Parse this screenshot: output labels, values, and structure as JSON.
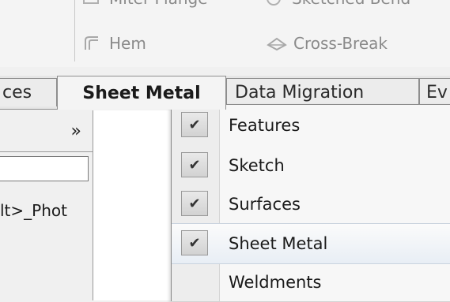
{
  "ribbon": {
    "top_items": [
      {
        "label": "Miter Flange",
        "icon": "miter-flange-icon"
      },
      {
        "label": "Sketched Bend",
        "icon": "sketched-bend-icon"
      }
    ],
    "hem_label": "Hem",
    "hem_icon": "hem-icon",
    "crossbreak_label": "Cross-Break",
    "crossbreak_icon": "cross-break-icon"
  },
  "tabs": {
    "prev_label": "ces",
    "active_label": "Sheet Metal",
    "next1_label": "Data Migration",
    "next2_label": "Ev"
  },
  "left_panel": {
    "expand_glyph": "»",
    "tree_text": "lt>_Phot"
  },
  "menu": {
    "items": [
      {
        "label": "Features",
        "checked": true
      },
      {
        "label": "Sketch",
        "checked": true
      },
      {
        "label": "Surfaces",
        "checked": true
      },
      {
        "label": "Sheet Metal",
        "checked": true,
        "highlighted": true
      },
      {
        "label": "Weldments",
        "checked": false
      }
    ],
    "check_glyph": "✔"
  }
}
